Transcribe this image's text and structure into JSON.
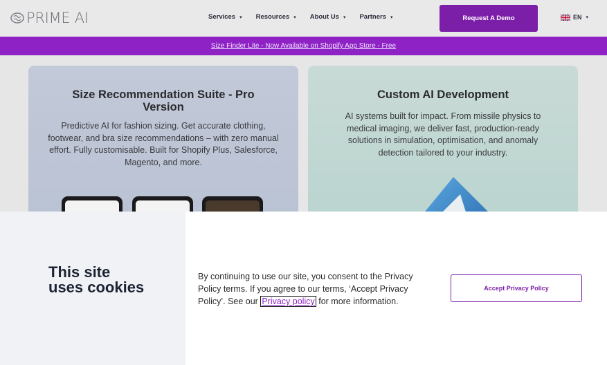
{
  "header": {
    "logo_text": "PRIME AI",
    "nav": [
      {
        "label": "Services"
      },
      {
        "label": "Resources"
      },
      {
        "label": "About Us"
      },
      {
        "label": "Partners"
      }
    ],
    "demo_label": "Request A Demo",
    "lang_label": "EN"
  },
  "banner": {
    "text": "Size Finder Lite - Now Available on Shopify App Store - Free"
  },
  "cards": {
    "pro": {
      "title": "Size Recommendation Suite - Pro Version",
      "desc": "Predictive AI for fashion sizing. Get accurate clothing, footwear, and bra size recommendations – with zero manual effort. Fully customisable. Built for Shopify Plus, Salesforce, Magento, and more."
    },
    "ai": {
      "title": "Custom AI Development",
      "desc": "AI systems built for impact. From missile physics to medical imaging, we deliver fast, production-ready solutions in simulation, optimisation, and anomaly detection tailored to your industry."
    }
  },
  "cookie": {
    "title": "This site uses cookies",
    "text_before": "By continuing to use our site, you consent to the Privacy Policy terms. If you agree to our terms, ‘Accept Privacy Policy’. See our ",
    "link_label": "Privacy policy",
    "text_after": " for more information.",
    "accept_label": "Accept Privacy Policy"
  },
  "colors": {
    "brand_purple": "#7b1ea8",
    "banner_purple": "#8e22c4"
  }
}
